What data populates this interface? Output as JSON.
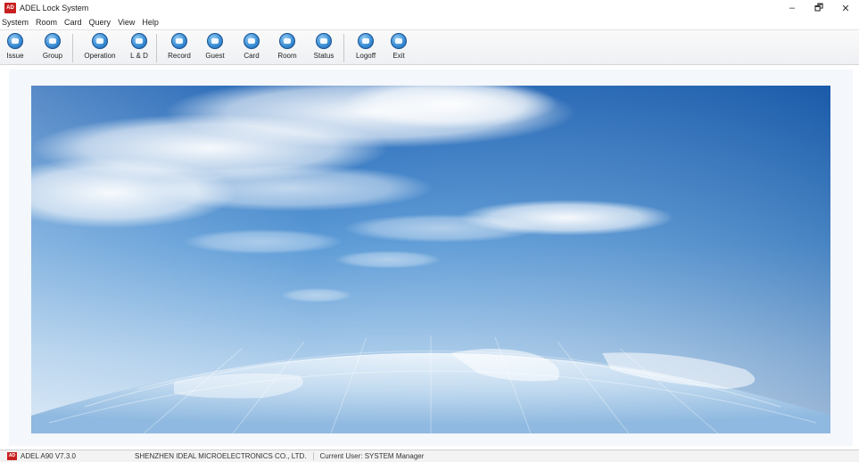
{
  "window": {
    "app_icon_text": "AD",
    "title": "ADEL Lock System",
    "minimize_symbol": "–",
    "maximize_symbol": "🗗",
    "close_symbol": "✕"
  },
  "menu": {
    "items": [
      "System",
      "Room",
      "Card",
      "Query",
      "View",
      "Help"
    ]
  },
  "toolbar": {
    "buttons": [
      {
        "label": "Issue",
        "icon": "issue-icon"
      },
      {
        "label": "Group",
        "icon": "group-icon"
      },
      {
        "label": "Operation",
        "icon": "operation-icon"
      },
      {
        "label": "L & D",
        "icon": "lost-damage-icon"
      },
      {
        "label": "Record",
        "icon": "record-icon"
      },
      {
        "label": "Guest",
        "icon": "guest-icon"
      },
      {
        "label": "Card",
        "icon": "card-icon"
      },
      {
        "label": "Room",
        "icon": "room-icon"
      },
      {
        "label": "Status",
        "icon": "status-icon"
      },
      {
        "label": "Logoff",
        "icon": "logoff-icon"
      },
      {
        "label": "Exit",
        "icon": "exit-icon"
      }
    ],
    "icon_color": "#3b8fd6"
  },
  "background": {
    "sky_top": "#1f63b4",
    "sky_mid": "#5b9ad6",
    "sky_horizon": "#cfe2f3"
  },
  "status": {
    "icon_text": "AD",
    "version": "ADEL A90 V7.3.0",
    "company": "SHENZHEN IDEAL MICROELECTRONICS CO., LTD.",
    "user": "Current User: SYSTEM Manager"
  }
}
